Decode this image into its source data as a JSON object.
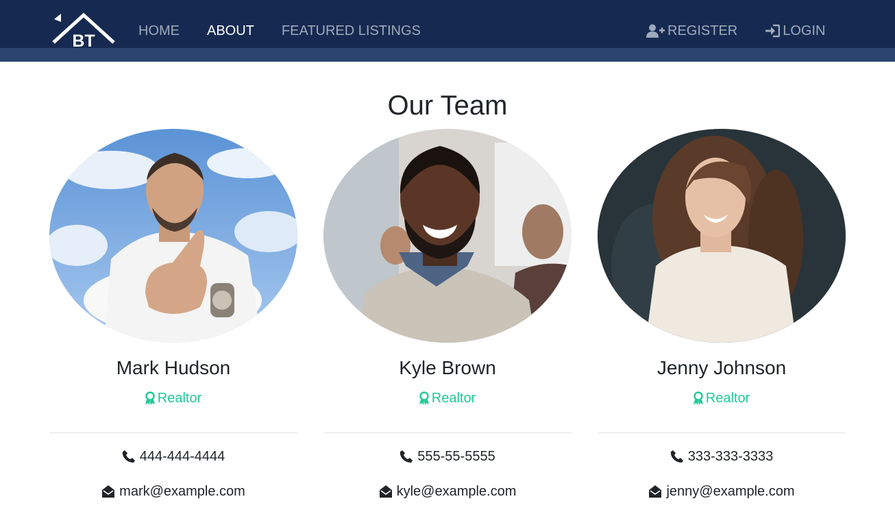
{
  "nav": {
    "logo_text": "BT",
    "links": [
      "HOME",
      "ABOUT",
      "FEATURED LISTINGS"
    ],
    "active": "ABOUT",
    "register_label": "REGISTER",
    "login_label": "LOGIN",
    "icons": [
      "user-plus-icon",
      "sign-in-icon"
    ]
  },
  "colors": {
    "navbar": "#162a51",
    "subbar": "#2b4470",
    "accent": "#20c997",
    "text": "#212529"
  },
  "section": {
    "title": "Our Team"
  },
  "members": [
    {
      "name": "Mark Hudson",
      "role": "Realtor",
      "phone": "444-444-4444",
      "email": "mark@example.com"
    },
    {
      "name": "Kyle Brown",
      "role": "Realtor",
      "phone": "555-55-5555",
      "email": "kyle@example.com"
    },
    {
      "name": "Jenny Johnson",
      "role": "Realtor",
      "phone": "333-333-3333",
      "email": "jenny@example.com"
    }
  ]
}
